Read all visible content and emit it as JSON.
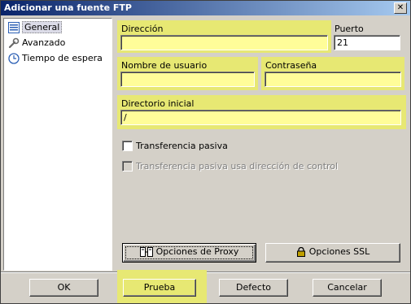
{
  "window": {
    "title": "Adicionar una fuente FTP"
  },
  "sidebar": {
    "items": [
      {
        "label": "General",
        "icon": "list-icon"
      },
      {
        "label": "Avanzado",
        "icon": "wrench-icon"
      },
      {
        "label": "Tiempo de espera",
        "icon": "clock-icon"
      }
    ]
  },
  "form": {
    "address_label": "Dirección",
    "address_value": "",
    "port_label": "Puerto",
    "port_value": "21",
    "username_label": "Nombre de usuario",
    "username_value": "",
    "password_label": "Contraseña",
    "password_value": "",
    "initdir_label": "Directorio inicial",
    "initdir_value": "/",
    "passive_label": "Transferencia pasiva",
    "passive_control_label": "Transferencia pasiva usa dirección de control",
    "proxy_button": "Opciones de Proxy",
    "ssl_button": "Opciones SSL"
  },
  "footer": {
    "ok": "OK",
    "test": "Prueba",
    "default": "Defecto",
    "cancel": "Cancelar"
  },
  "colors": {
    "highlight": "#e7e873",
    "field_highlight": "#fffd99",
    "title_start": "#0a246a",
    "title_end": "#a6caf0"
  }
}
